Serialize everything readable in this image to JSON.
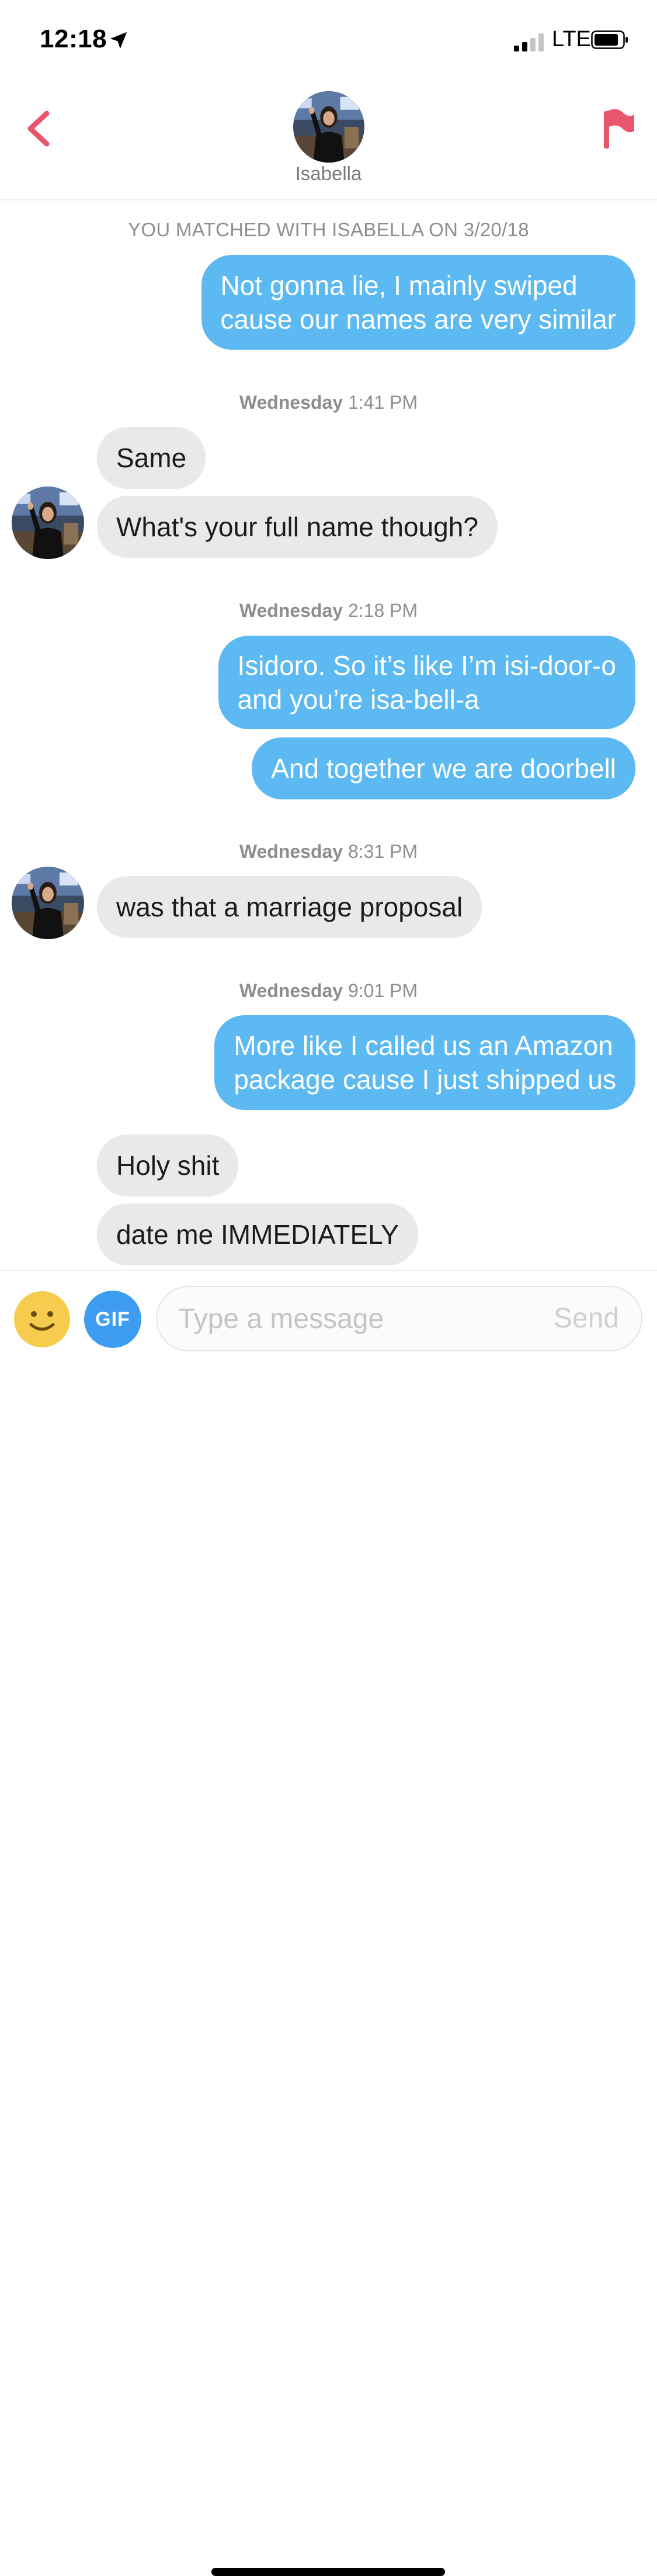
{
  "status_bar": {
    "time": "12:18",
    "network": "LTE"
  },
  "header": {
    "contact_name": "Isabella"
  },
  "match_line": "YOU MATCHED WITH ISABELLA ON 3/20/18",
  "timestamps": [
    {
      "day": "Wednesday",
      "time": "1:41 PM"
    },
    {
      "day": "Wednesday",
      "time": "2:18 PM"
    },
    {
      "day": "Wednesday",
      "time": "8:31 PM"
    },
    {
      "day": "Wednesday",
      "time": "9:01 PM"
    }
  ],
  "messages": [
    {
      "from": "me",
      "text": "Not gonna lie, I mainly swiped\ncause our names are very similar"
    },
    {
      "from": "them",
      "text": "Same"
    },
    {
      "from": "them",
      "text": "What's your full name though?"
    },
    {
      "from": "me",
      "text": "Isidoro. So it’s like I’m isi-door-o\nand you’re isa-bell-a"
    },
    {
      "from": "me",
      "text": "And together we are doorbell"
    },
    {
      "from": "them",
      "text": "was that a marriage proposal"
    },
    {
      "from": "me",
      "text": "More like I called us an Amazon\npackage cause I just shipped us"
    },
    {
      "from": "them",
      "text": "Holy shit"
    },
    {
      "from": "them",
      "text": "date me IMMEDIATELY"
    }
  ],
  "composer": {
    "gif_label": "GIF",
    "placeholder": "Type a message",
    "send_label": "Send"
  },
  "colors": {
    "accent": "#e8566c",
    "outgoing_bubble": "#5cb9f2",
    "incoming_bubble": "#e9e9e9",
    "gif_button": "#3e9df0"
  },
  "icons": [
    "location-arrow-icon",
    "signal-icon",
    "battery-icon",
    "back-chevron-icon",
    "flag-icon",
    "emoji-icon"
  ]
}
